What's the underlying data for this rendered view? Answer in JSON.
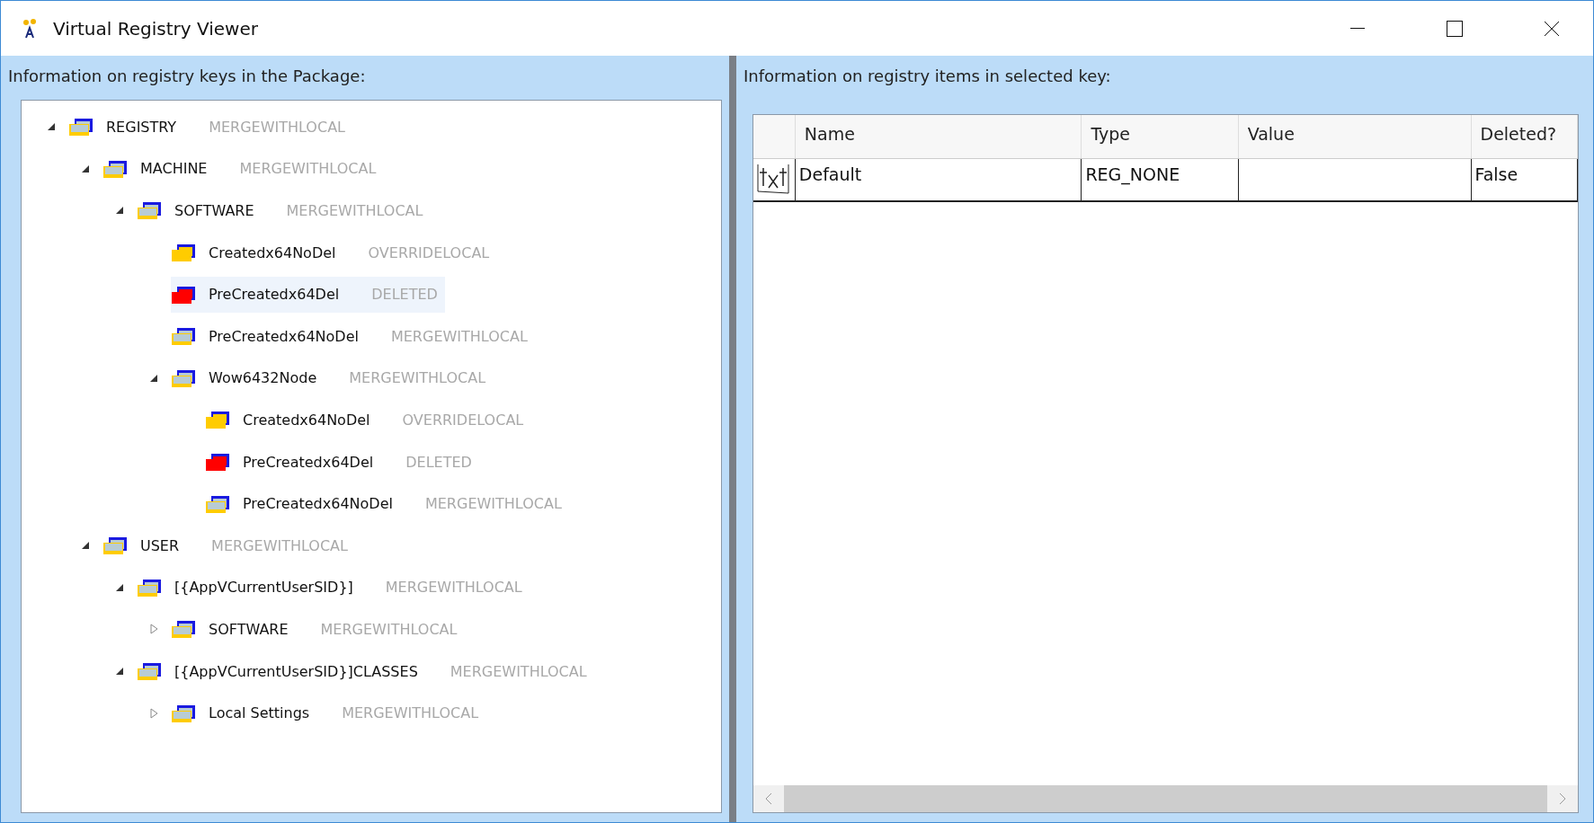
{
  "window": {
    "title": "Virtual Registry Viewer"
  },
  "left_panel": {
    "label": "Information on registry keys in the Package:",
    "tree": [
      {
        "name": "REGISTRY",
        "status": "MERGEWITHLOCAL",
        "kind": "merge",
        "expanded": true,
        "selected": false,
        "children": [
          {
            "name": "MACHINE",
            "status": "MERGEWITHLOCAL",
            "kind": "merge",
            "expanded": true,
            "selected": false,
            "children": [
              {
                "name": "SOFTWARE",
                "status": "MERGEWITHLOCAL",
                "kind": "merge",
                "expanded": true,
                "selected": false,
                "children": [
                  {
                    "name": "Createdx64NoDel",
                    "status": "OVERRIDELOCAL",
                    "kind": "override",
                    "selected": false
                  },
                  {
                    "name": "PreCreatedx64Del",
                    "status": "DELETED",
                    "kind": "deleted",
                    "selected": true
                  },
                  {
                    "name": "PreCreatedx64NoDel",
                    "status": "MERGEWITHLOCAL",
                    "kind": "merge",
                    "selected": false
                  },
                  {
                    "name": "Wow6432Node",
                    "status": "MERGEWITHLOCAL",
                    "kind": "merge",
                    "expanded": true,
                    "selected": false,
                    "children": [
                      {
                        "name": "Createdx64NoDel",
                        "status": "OVERRIDELOCAL",
                        "kind": "override",
                        "selected": false
                      },
                      {
                        "name": "PreCreatedx64Del",
                        "status": "DELETED",
                        "kind": "deleted",
                        "selected": false
                      },
                      {
                        "name": "PreCreatedx64NoDel",
                        "status": "MERGEWITHLOCAL",
                        "kind": "merge",
                        "selected": false
                      }
                    ]
                  }
                ]
              }
            ]
          },
          {
            "name": "USER",
            "status": "MERGEWITHLOCAL",
            "kind": "merge",
            "expanded": true,
            "selected": false,
            "children": [
              {
                "name": "[{AppVCurrentUserSID}]",
                "status": "MERGEWITHLOCAL",
                "kind": "merge",
                "expanded": true,
                "selected": false,
                "children": [
                  {
                    "name": "SOFTWARE",
                    "status": "MERGEWITHLOCAL",
                    "kind": "merge",
                    "expanded": false,
                    "selected": false
                  }
                ]
              },
              {
                "name": "[{AppVCurrentUserSID}]CLASSES",
                "status": "MERGEWITHLOCAL",
                "kind": "merge",
                "expanded": true,
                "selected": false,
                "children": [
                  {
                    "name": "Local Settings",
                    "status": "MERGEWITHLOCAL",
                    "kind": "merge",
                    "expanded": false,
                    "selected": false
                  }
                ]
              }
            ]
          }
        ]
      }
    ]
  },
  "right_panel": {
    "label": "Information on registry items in selected key:",
    "table": {
      "columns": [
        "Name",
        "Type",
        "Value",
        "Deleted?"
      ],
      "rows": [
        {
          "cells": [
            "Default",
            "REG_NONE",
            "",
            "False"
          ]
        }
      ]
    }
  }
}
